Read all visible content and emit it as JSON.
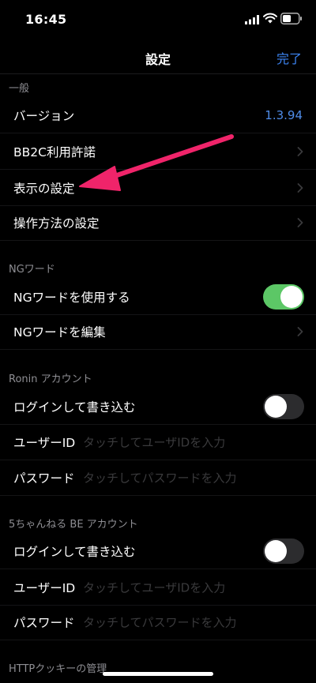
{
  "status": {
    "time": "16:45"
  },
  "nav": {
    "title": "設定",
    "done_label": "完了"
  },
  "sections": {
    "general": {
      "header": "一般",
      "version_label": "バージョン",
      "version_value": "1.3.94",
      "license_label": "BB2C利用許諾",
      "display_label": "表示の設定",
      "operation_label": "操作方法の設定"
    },
    "ngword": {
      "header": "NGワード",
      "use_label": "NGワードを使用する",
      "use_enabled": true,
      "edit_label": "NGワードを編集"
    },
    "ronin": {
      "header": "Ronin アカウント",
      "login_label": "ログインして書き込む",
      "login_enabled": false,
      "userid_label": "ユーザーID",
      "userid_placeholder": "タッチしてユーザIDを入力",
      "password_label": "パスワード",
      "password_placeholder": "タッチしてパスワードを入力"
    },
    "be": {
      "header": "5ちゃんねる BE アカウント",
      "login_label": "ログインして書き込む",
      "login_enabled": false,
      "userid_label": "ユーザーID",
      "userid_placeholder": "タッチしてユーザIDを入力",
      "password_label": "パスワード",
      "password_placeholder": "タッチしてパスワードを入力"
    },
    "cookie": {
      "header": "HTTPクッキーの管理"
    }
  },
  "colors": {
    "accent": "#3d86f5",
    "toggle_on": "#5cc766",
    "annotation_arrow": "#f0246a"
  }
}
